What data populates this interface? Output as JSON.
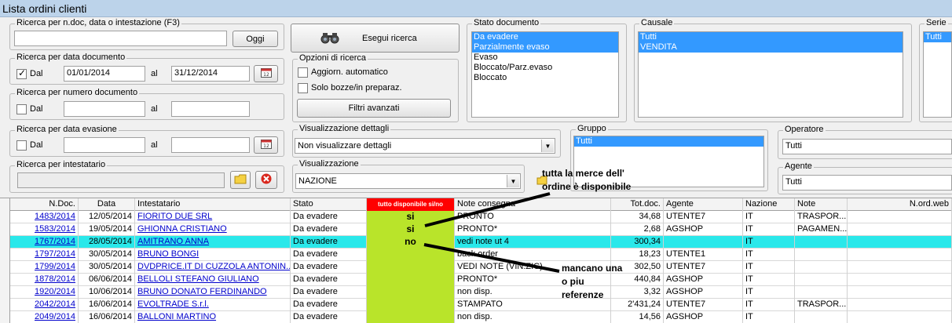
{
  "window": {
    "title": "Lista ordini clienti"
  },
  "search_doc": {
    "label": "Ricerca per n.doc, data o intestazione (F3)",
    "value": "",
    "today_button": "Oggi"
  },
  "search_button": {
    "label": "Esegui ricerca"
  },
  "date_doc": {
    "label": "Ricerca per data documento",
    "checked": true,
    "from_label": "Dal",
    "from": "01/01/2014",
    "to_label": "al",
    "to": "31/12/2014"
  },
  "num_doc": {
    "label": "Ricerca per numero documento",
    "from_label": "Dal",
    "to_label": "al"
  },
  "date_ev": {
    "label": "Ricerca per data evasione",
    "from_label": "Dal",
    "to_label": "al"
  },
  "holder": {
    "label": "Ricerca per intestatario"
  },
  "options": {
    "label": "Opzioni di ricerca",
    "auto_refresh": "Aggiorn. automatico",
    "drafts": "Solo bozze/in preparaz.",
    "advanced": "Filtri avanzati"
  },
  "details": {
    "label": "Visualizzazione dettagli",
    "value": "Non visualizzare dettagli"
  },
  "view": {
    "label": "Visualizzazione",
    "value": "NAZIONE"
  },
  "doc_state": {
    "label": "Stato documento",
    "items": [
      {
        "text": "Da evadere",
        "selected": true
      },
      {
        "text": "Parzialmente evaso",
        "selected": true
      },
      {
        "text": "Evaso",
        "selected": false
      },
      {
        "text": "Bloccato/Parz.evaso",
        "selected": false
      },
      {
        "text": "Bloccato",
        "selected": false
      }
    ]
  },
  "reason": {
    "label": "Causale",
    "items": [
      {
        "text": "Tutti",
        "selected": true
      },
      {
        "text": "VENDITA",
        "selected": true
      }
    ]
  },
  "series": {
    "label": "Serie",
    "items": [
      {
        "text": "Tutti",
        "selected": true
      }
    ]
  },
  "group": {
    "label": "Gruppo",
    "items": [
      {
        "text": "Tutti",
        "selected": true
      }
    ]
  },
  "operator": {
    "label": "Operatore",
    "value": "Tutti"
  },
  "agent": {
    "label": "Agente",
    "value": "Tutti"
  },
  "annotations": {
    "top_line1": "tutta la merce dell'",
    "top_line2": "ordine è disponibile",
    "bottom_line1": "mancano una",
    "bottom_line2": "o piu",
    "bottom_line3": "referenze"
  },
  "table": {
    "headers": {
      "ndoc": "N.Doc.",
      "data": "Data",
      "intestatario": "Intestatario",
      "stato": "Stato",
      "disp": "tutto disponibile si/no",
      "note_consegna": "Note consegna",
      "totdoc": "Tot.doc.",
      "agente": "Agente",
      "nazione": "Nazione",
      "note": "Note",
      "nordweb": "N.ord.web"
    },
    "rows": [
      {
        "ndoc": "1483/2014",
        "data": "12/05/2014",
        "intestatario": "FIORITO DUE SRL",
        "stato": "Da evadere",
        "disp": "si",
        "note_consegna": "PRONTO",
        "totdoc": "34,68",
        "agente": "UTENTE7",
        "nazione": "IT",
        "note": "TRASPOR...",
        "nordweb": ""
      },
      {
        "ndoc": "1583/2014",
        "data": "19/05/2014",
        "intestatario": "GHIONNA CRISTIANO",
        "stato": "Da evadere",
        "disp": "si",
        "note_consegna": "PRONTO*",
        "totdoc": "2,68",
        "agente": "AGSHOP",
        "nazione": "IT",
        "note": "PAGAMEN...",
        "nordweb": ""
      },
      {
        "ndoc": "1767/2014",
        "data": "28/05/2014",
        "intestatario": "AMITRANO ANNA",
        "stato": "Da evadere",
        "disp": "no",
        "note_consegna": "vedi note ut 4",
        "totdoc": "300,34",
        "agente": "",
        "nazione": "IT",
        "note": "",
        "nordweb": "",
        "highlight": true
      },
      {
        "ndoc": "1797/2014",
        "data": "30/05/2014",
        "intestatario": "BRUNO BONGI",
        "stato": "Da evadere",
        "disp": "",
        "note_consegna": "back order",
        "totdoc": "18,23",
        "agente": "UTENTE1",
        "nazione": "IT",
        "note": "",
        "nordweb": ""
      },
      {
        "ndoc": "1799/2014",
        "data": "30/05/2014",
        "intestatario": "DVDPRICE.IT DI CUZZOLA ANTONIN...",
        "stato": "Da evadere",
        "disp": "",
        "note_consegna": "VEDI NOTE (VIN.ZIC)",
        "totdoc": "302,50",
        "agente": "UTENTE7",
        "nazione": "IT",
        "note": "",
        "nordweb": ""
      },
      {
        "ndoc": "1878/2014",
        "data": "06/06/2014",
        "intestatario": "BELLOLI STEFANO GIULIANO",
        "stato": "Da evadere",
        "disp": "",
        "note_consegna": "PRONTO*",
        "totdoc": "440,84",
        "agente": "AGSHOP",
        "nazione": "IT",
        "note": "",
        "nordweb": ""
      },
      {
        "ndoc": "1920/2014",
        "data": "10/06/2014",
        "intestatario": "BRUNO DONATO FERDINANDO",
        "stato": "Da evadere",
        "disp": "",
        "note_consegna": "non disp.",
        "totdoc": "3,32",
        "agente": "AGSHOP",
        "nazione": "IT",
        "note": "",
        "nordweb": ""
      },
      {
        "ndoc": "2042/2014",
        "data": "16/06/2014",
        "intestatario": "EVOLTRADE S.r.l.",
        "stato": "Da evadere",
        "disp": "",
        "note_consegna": "STAMPATO",
        "totdoc": "2'431,24",
        "agente": "UTENTE7",
        "nazione": "IT",
        "note": "TRASPOR...",
        "nordweb": ""
      },
      {
        "ndoc": "2049/2014",
        "data": "16/06/2014",
        "intestatario": "BALLONI MARTINO",
        "stato": "Da evadere",
        "disp": "",
        "note_consegna": "non disp.",
        "totdoc": "14,56",
        "agente": "AGSHOP",
        "nazione": "IT",
        "note": "",
        "nordweb": ""
      }
    ]
  }
}
